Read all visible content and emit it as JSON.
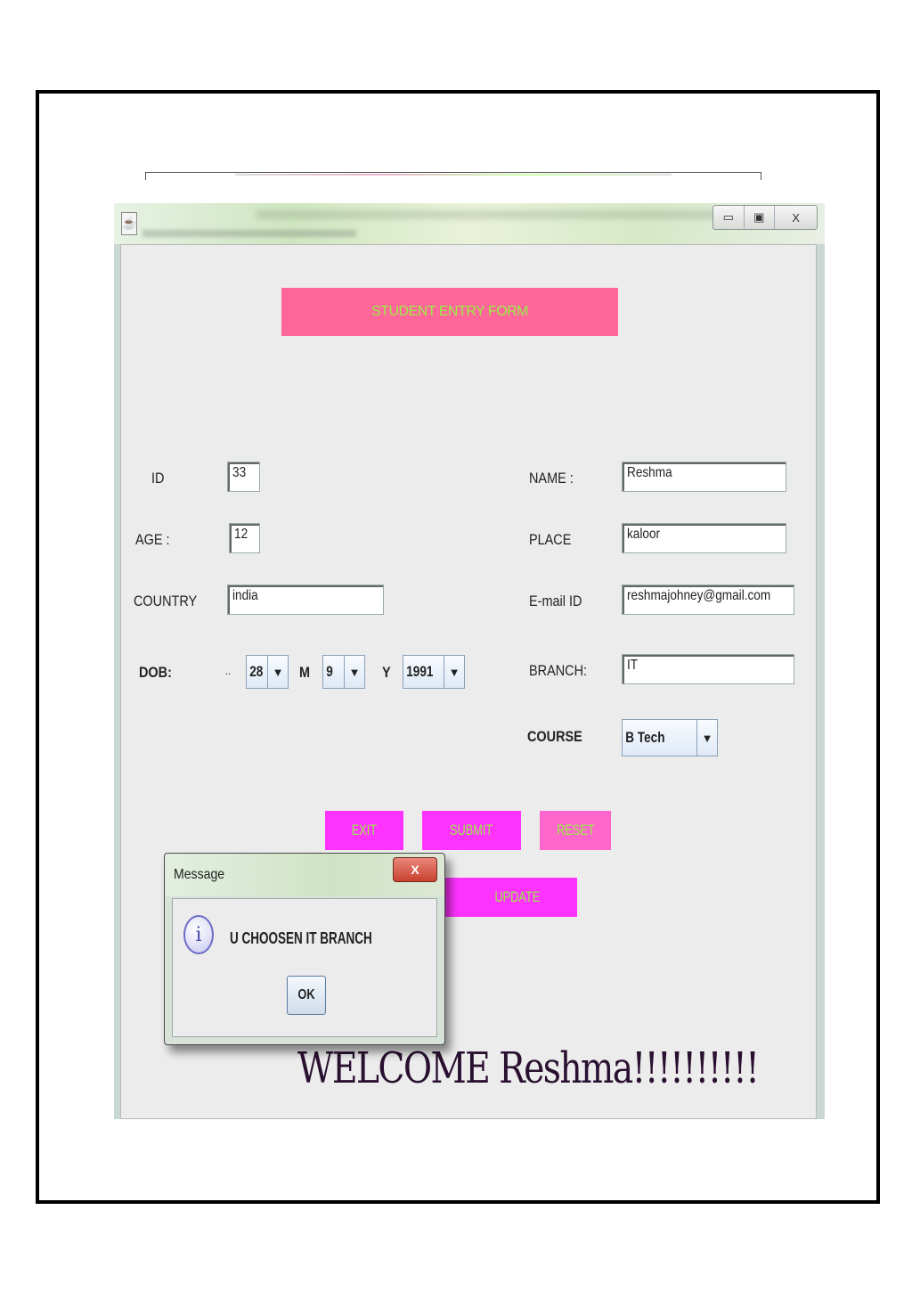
{
  "window": {
    "controls": {
      "minimize": "▭",
      "maximize": "▣",
      "close": "X"
    }
  },
  "form": {
    "banner": "STUDENT ENTRY FORM",
    "id": {
      "label": "ID",
      "value": "33"
    },
    "age": {
      "label": "AGE  :",
      "value": "12"
    },
    "country": {
      "label": "COUNTRY",
      "value": "india"
    },
    "dob": {
      "label": "DOB:",
      "day_prefix": "..",
      "day": "28",
      "month_label": "M",
      "month": "9",
      "year_label": "Y",
      "year": "1991"
    },
    "name": {
      "label": "NAME  :",
      "value": "Reshma"
    },
    "place": {
      "label": "PLACE",
      "value": "kaloor"
    },
    "email": {
      "label": "E-mail ID",
      "value": "reshmajohney@gmail.com"
    },
    "branch": {
      "label": "BRANCH:",
      "value": "IT"
    },
    "course": {
      "label": "COURSE",
      "value": "B Tech"
    },
    "buttons": {
      "exit": "EXIT",
      "submit": "SUBMIT",
      "reset": "RESET",
      "update": "UPDATE"
    },
    "welcome": "WELCOME Reshma!!!!!!!!!!"
  },
  "dialog": {
    "title": "Message",
    "close": "X",
    "icon": "info-icon",
    "message": "U CHOOSEN IT BRANCH",
    "ok": "OK"
  }
}
